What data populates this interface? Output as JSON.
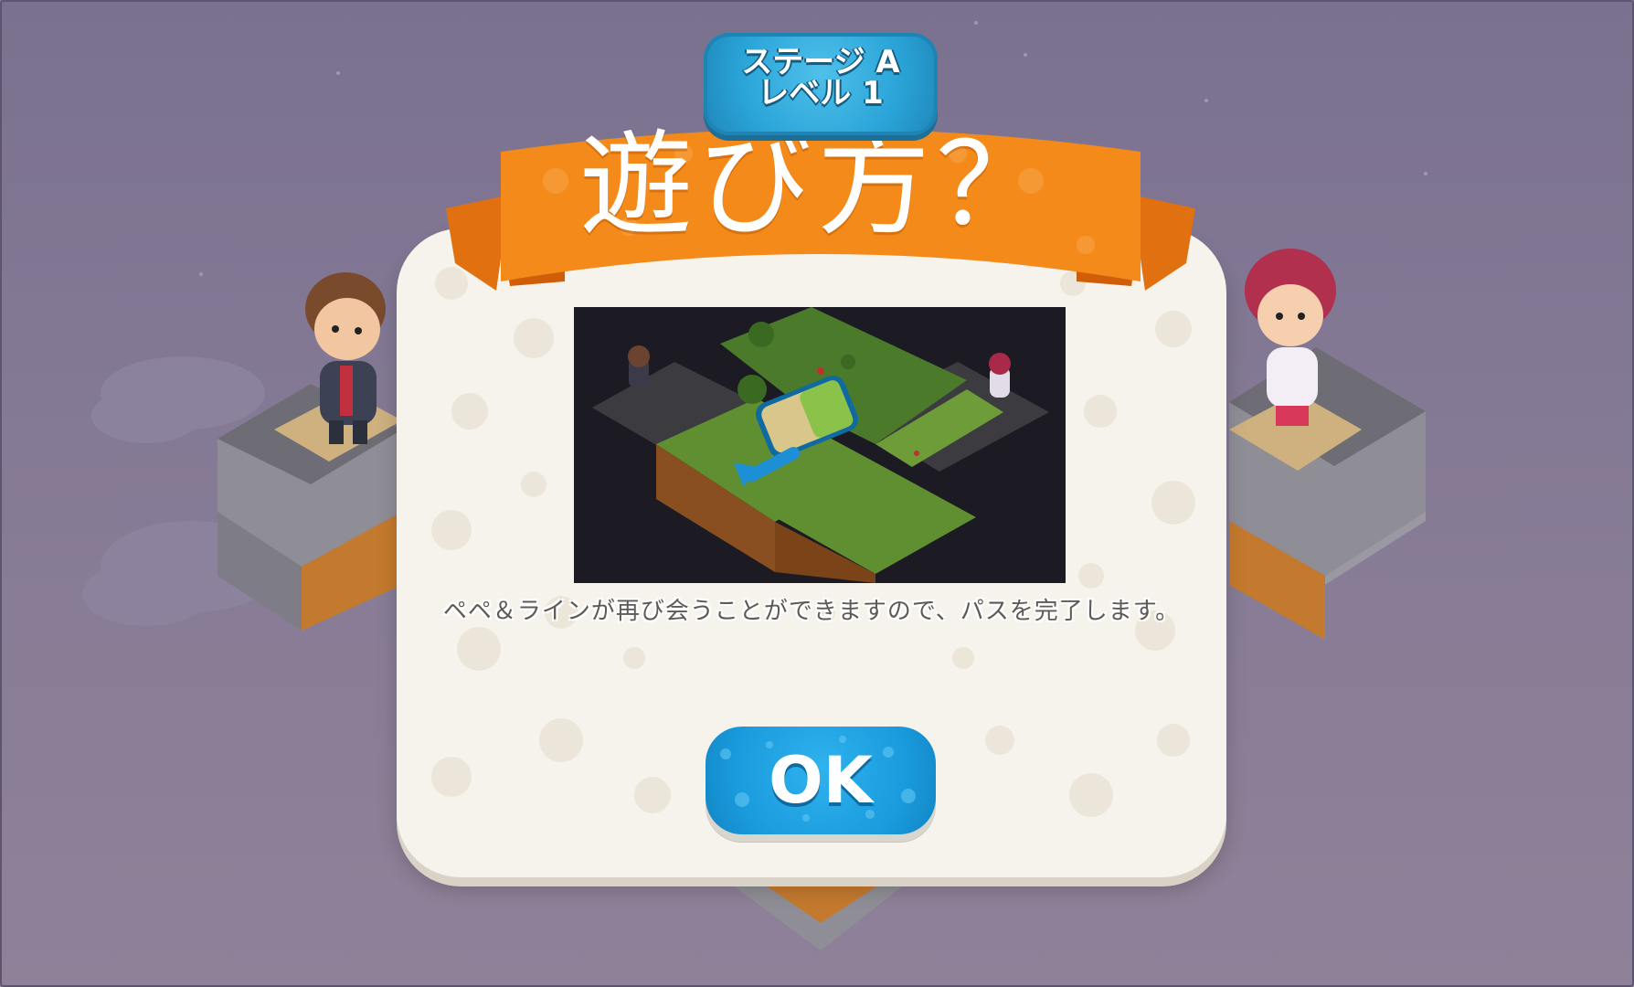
{
  "header": {
    "stage_label": "ステージ A",
    "level_label": "レベル 1"
  },
  "dialog": {
    "title": "遊び方？",
    "description": "ペペ＆ラインが再び会うことができますので、パスを完了します。",
    "ok_label": "OK"
  },
  "colors": {
    "ribbon": "#f48a1a",
    "badge": "#2aa4d8",
    "ok_button": "#1a9bdd",
    "panel": "#f5f3ec",
    "background": "#837893"
  },
  "icons": {
    "tutorial_arrow": "arrow-down-left-icon"
  }
}
